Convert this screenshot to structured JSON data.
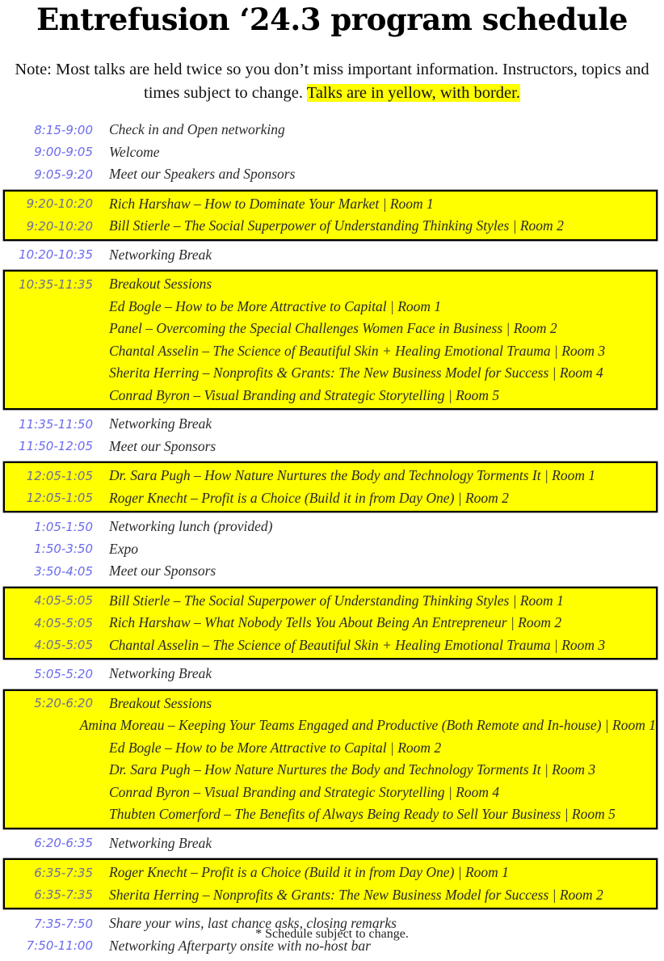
{
  "header": {
    "title": "Entrefusion ‘24.3 program schedule",
    "note_plain": "Note: Most talks are held twice so you don’t miss important information. Instructors, topics and times subject to change. ",
    "note_highlight": "Talks are in yellow, with border."
  },
  "colors": {
    "highlight": "#ffff00",
    "time_text": "#6b6bf0",
    "border": "#000000"
  },
  "schedule": [
    {
      "type": "plain",
      "rows": [
        {
          "time": "8:15-9:00",
          "desc": "Check in and Open networking"
        },
        {
          "time": "9:00-9:05",
          "desc": "Welcome"
        },
        {
          "time": "9:05-9:20",
          "desc": "Meet our Speakers and Sponsors"
        }
      ]
    },
    {
      "type": "talk",
      "rows": [
        {
          "time": "9:20-10:20",
          "desc": "Rich Harshaw – How to Dominate Your Market | Room 1"
        },
        {
          "time": "9:20-10:20",
          "desc": "Bill Stierle – The Social Superpower of Understanding Thinking Styles | Room 2"
        }
      ]
    },
    {
      "type": "plain",
      "rows": [
        {
          "time": "10:20-10:35",
          "desc": "Networking Break"
        }
      ]
    },
    {
      "type": "talk",
      "rows": [
        {
          "time": "10:35-11:35",
          "desc": "Breakout Sessions"
        },
        {
          "time": "",
          "desc": "Ed Bogle – How to be More Attractive to Capital | Room 1"
        },
        {
          "time": "",
          "desc": "Panel – Overcoming the Special Challenges Women Face in Business | Room 2"
        },
        {
          "time": "",
          "desc": "Chantal Asselin – The Science of Beautiful Skin + Healing Emotional Trauma | Room 3"
        },
        {
          "time": "",
          "desc": "Sherita Herring – Nonprofits & Grants: The New Business Model for Success | Room 4"
        },
        {
          "time": "",
          "desc": "Conrad Byron – Visual Branding and Strategic Storytelling | Room 5"
        }
      ]
    },
    {
      "type": "plain",
      "rows": [
        {
          "time": "11:35-11:50",
          "desc": "Networking Break"
        },
        {
          "time": "11:50-12:05",
          "desc": "Meet our Sponsors"
        }
      ]
    },
    {
      "type": "talk",
      "rows": [
        {
          "time": "12:05-1:05",
          "desc": "Dr. Sara Pugh – How Nature Nurtures the Body and Technology Torments It | Room 1"
        },
        {
          "time": "12:05-1:05",
          "desc": "Roger Knecht – Profit is a Choice (Build it in from Day One) | Room 2"
        }
      ]
    },
    {
      "type": "plain",
      "rows": [
        {
          "time": "1:05-1:50",
          "desc": "Networking lunch (provided)"
        },
        {
          "time": "1:50-3:50",
          "desc": "Expo"
        },
        {
          "time": "3:50-4:05",
          "desc": "Meet our Sponsors"
        }
      ]
    },
    {
      "type": "talk",
      "rows": [
        {
          "time": "4:05-5:05",
          "desc": "Bill Stierle – The Social Superpower of Understanding Thinking Styles | Room 1"
        },
        {
          "time": "4:05-5:05",
          "desc": "Rich Harshaw – What Nobody Tells You About Being An Entrepreneur | Room 2"
        },
        {
          "time": "4:05-5:05",
          "desc": "Chantal Asselin – The Science of Beautiful Skin + Healing Emotional Trauma | Room 3"
        }
      ]
    },
    {
      "type": "plain",
      "rows": [
        {
          "time": "5:05-5:20",
          "desc": "Networking Break"
        }
      ]
    },
    {
      "type": "talk",
      "rows": [
        {
          "time": "5:20-6:20",
          "desc": "Breakout Sessions"
        },
        {
          "time": "",
          "desc": "Amina Moreau – Keeping Your Teams Engaged and Productive (Both Remote and In-house) | Room 1"
        },
        {
          "time": "",
          "desc": "Ed Bogle – How to be More Attractive to Capital | Room 2"
        },
        {
          "time": "",
          "desc": "Dr. Sara Pugh – How Nature Nurtures the Body and Technology Torments It | Room 3"
        },
        {
          "time": "",
          "desc": "Conrad Byron – Visual Branding and Strategic Storytelling | Room 4"
        },
        {
          "time": "",
          "desc": "Thubten Comerford – The Benefits of Always Being Ready to Sell Your Business | Room 5"
        }
      ]
    },
    {
      "type": "plain",
      "rows": [
        {
          "time": "6:20-6:35",
          "desc": "Networking Break"
        }
      ]
    },
    {
      "type": "talk",
      "rows": [
        {
          "time": "6:35-7:35",
          "desc": "Roger Knecht – Profit is a Choice (Build it in from Day One) | Room 1"
        },
        {
          "time": "6:35-7:35",
          "desc": "Sherita Herring – Nonprofits & Grants: The New Business Model for Success | Room 2"
        }
      ]
    },
    {
      "type": "plain",
      "rows": [
        {
          "time": "7:35-7:50",
          "desc": "Share your wins, last chance asks, closing remarks"
        },
        {
          "time": "7:50-11:00",
          "desc": "Networking Afterparty onsite with no-host bar"
        }
      ]
    }
  ],
  "footer": {
    "text": "* Schedule subject to change."
  }
}
